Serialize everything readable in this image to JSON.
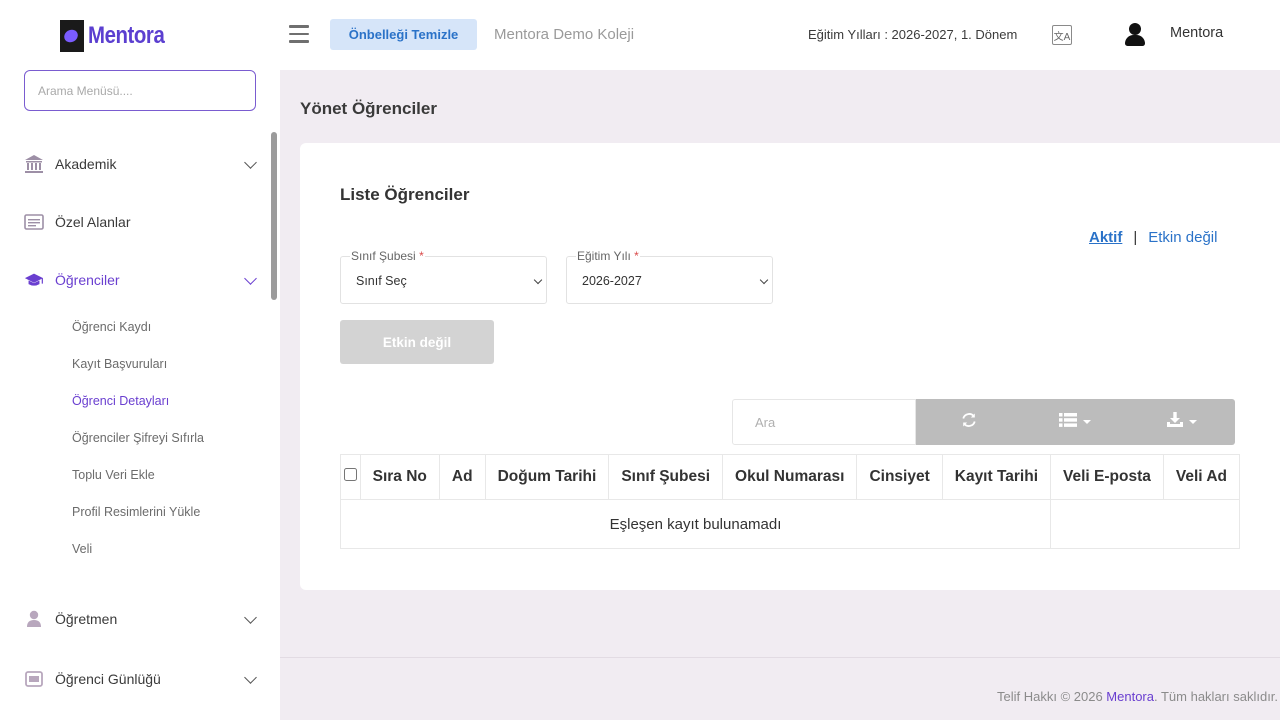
{
  "brand": {
    "name": "Mentora",
    "accent": "#6a3fd0"
  },
  "sidebar": {
    "search_placeholder": "Arama Menüsü....",
    "items": [
      {
        "label": "Akademik",
        "icon": "bank-icon",
        "expandable": true
      },
      {
        "label": "Özel Alanlar",
        "icon": "list-card-icon",
        "expandable": false
      },
      {
        "label": "Öğrenciler",
        "icon": "graduation-cap-icon",
        "expandable": true,
        "active": true
      },
      {
        "label": "Öğretmen",
        "icon": "user-icon",
        "expandable": true
      },
      {
        "label": "Öğrenci Günlüğü",
        "icon": "envelope-icon",
        "expandable": true
      }
    ],
    "sub_items": [
      {
        "label": "Öğrenci Kaydı"
      },
      {
        "label": "Kayıt Başvuruları"
      },
      {
        "label": "Öğrenci Detayları",
        "active": true
      },
      {
        "label": "Öğrenciler Şifreyi Sıfırla"
      },
      {
        "label": "Toplu Veri Ekle"
      },
      {
        "label": "Profil Resimlerini Yükle"
      },
      {
        "label": "Veli"
      }
    ]
  },
  "header": {
    "cache_button": "Önbelleği Temizle",
    "school_name": "Mentora Demo Koleji",
    "edu_years": "Eğitim Yılları : 2026-2027, 1. Dönem",
    "user_name": "Mentora"
  },
  "main": {
    "page_title": "Yönet Öğrenciler",
    "card_title": "Liste Öğrenciler",
    "status_active": "Aktif",
    "status_separator": "|",
    "status_inactive": "Etkin değil",
    "class_field": {
      "label": "Sınıf Şubesi",
      "required_mark": "*",
      "value": "Sınıf Seç"
    },
    "year_field": {
      "label": "Eğitim Yılı",
      "required_mark": "*",
      "value": "2026-2027"
    },
    "inactive_button": "Etkin değil",
    "table_search_placeholder": "Ara",
    "toolbar_icons": [
      "refresh-icon",
      "columns-list-icon",
      "download-icon"
    ],
    "table": {
      "columns": [
        "Sıra No",
        "Ad",
        "Doğum Tarihi",
        "Sınıf Şubesi",
        "Okul Numarası",
        "Cinsiyet",
        "Kayıt Tarihi",
        "Veli E-posta",
        "Veli Ad"
      ],
      "empty_message": "Eşleşen kayıt bulunamadı"
    }
  },
  "footer": {
    "prefix": "Telif Hakkı © 2026 ",
    "brand": "Mentora",
    "suffix": ". Tüm hakları saklıdır."
  }
}
